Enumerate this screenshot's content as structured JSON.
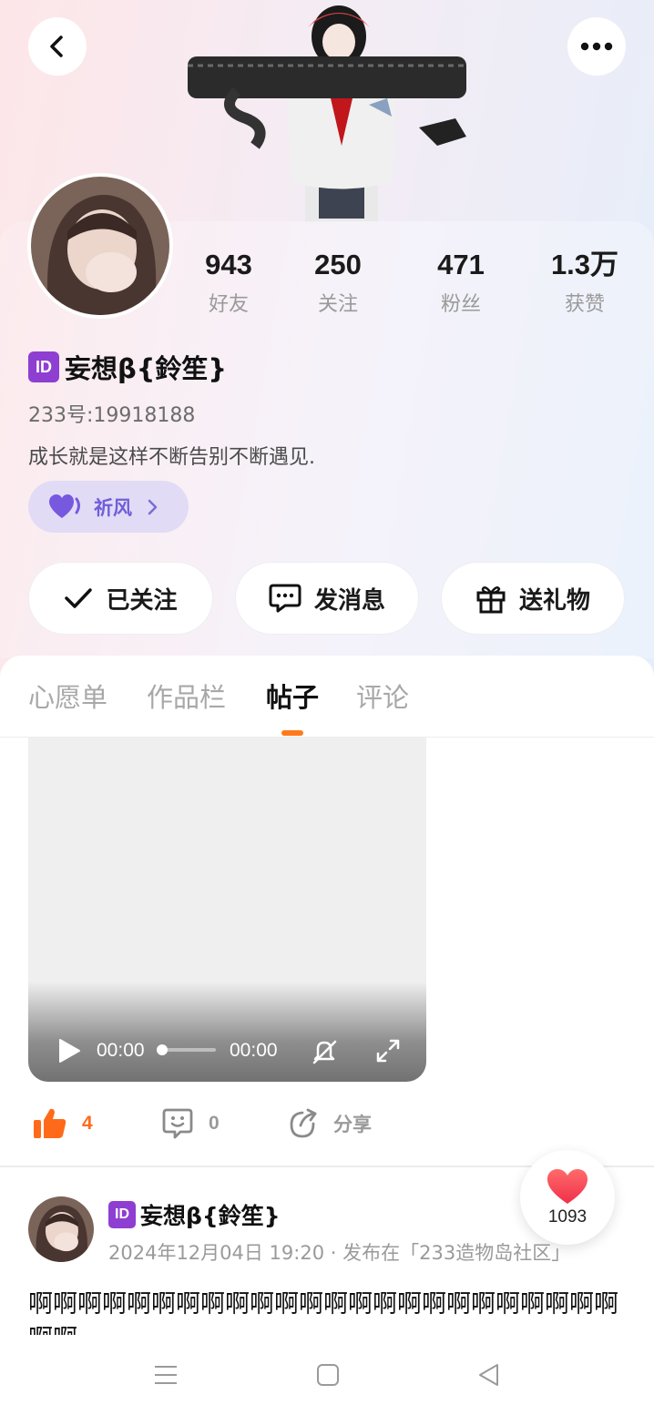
{
  "header": {
    "back_icon": "chevron-left-icon",
    "more_icon": "more-dots-icon"
  },
  "profile": {
    "stats": [
      {
        "value": "943",
        "label": "好友"
      },
      {
        "value": "250",
        "label": "关注"
      },
      {
        "value": "471",
        "label": "粉丝"
      },
      {
        "value": "1.3万",
        "label": "获赞"
      }
    ],
    "id_badge": "ID",
    "nickname": "妄想β{鈴笙}",
    "uid": "233号:19918188",
    "bio": "成长就是这样不断告别不断遇见.",
    "tag": {
      "label": "祈风",
      "color": "#6f5fd8"
    }
  },
  "actions": {
    "follow_label": "已关注",
    "message_label": "发消息",
    "gift_label": "送礼物"
  },
  "tabs": [
    {
      "label": "心愿单",
      "active": false
    },
    {
      "label": "作品栏",
      "active": false
    },
    {
      "label": "帖子",
      "active": true
    },
    {
      "label": "评论",
      "active": false
    }
  ],
  "video": {
    "current_time": "00:00",
    "total_time": "00:00",
    "progress": 0
  },
  "post_stats": {
    "likes": "4",
    "comments": "0",
    "share_label": "分享",
    "accent": "#ff6a1a"
  },
  "post": {
    "author": "妄想β{鈴笙}",
    "meta": "2024年12月04日 19:20 · 发布在「233造物岛社区」",
    "body": "啊啊啊啊啊啊啊啊啊啊啊啊啊啊啊啊啊啊啊啊啊啊啊啊啊啊"
  },
  "heart_fab": {
    "count": "1093"
  },
  "nav": {
    "menu_icon": "menu-icon",
    "home_icon": "home-square-icon",
    "back_icon": "back-triangle-icon"
  }
}
